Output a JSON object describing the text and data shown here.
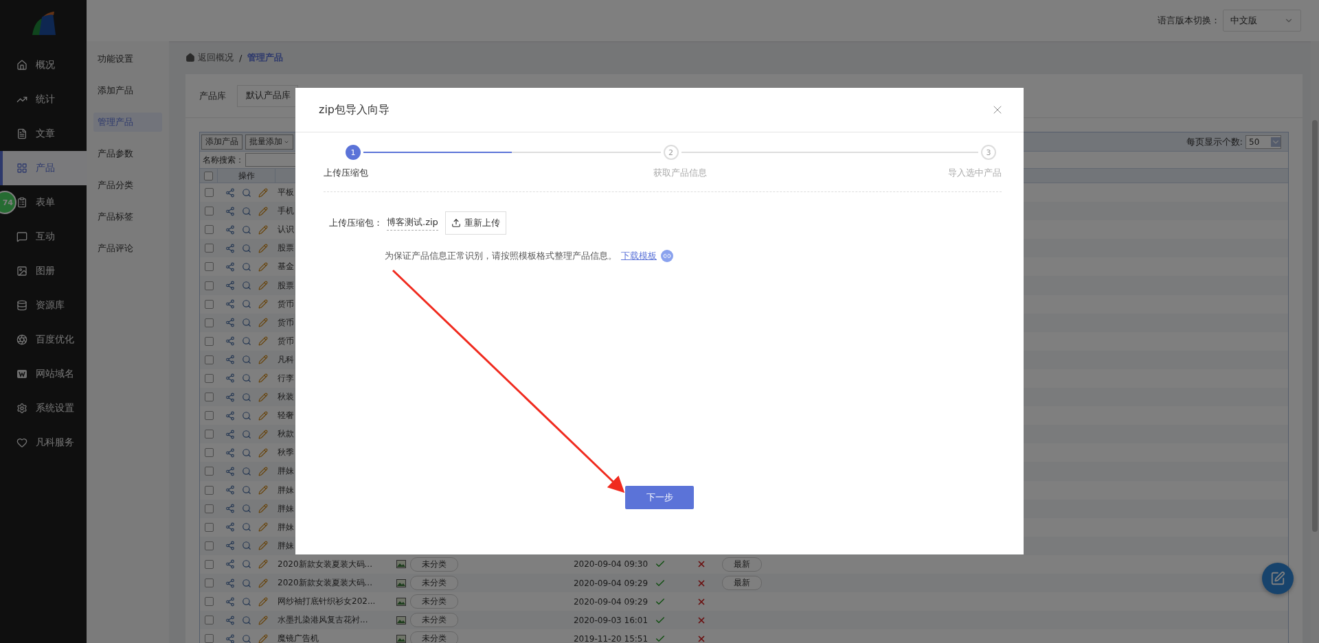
{
  "sidebar": {
    "items": [
      {
        "label": "概况",
        "selected": false
      },
      {
        "label": "统计",
        "selected": false
      },
      {
        "label": "文章",
        "selected": false
      },
      {
        "label": "产品",
        "selected": true
      },
      {
        "label": "表单",
        "selected": false,
        "badge": "74"
      },
      {
        "label": "互动",
        "selected": false
      },
      {
        "label": "图册",
        "selected": false
      },
      {
        "label": "资源库",
        "selected": false
      },
      {
        "label": "百度优化",
        "selected": false
      },
      {
        "label": "网站域名",
        "selected": false
      },
      {
        "label": "系统设置",
        "selected": false
      },
      {
        "label": "凡科服务",
        "selected": false
      }
    ]
  },
  "submenu": {
    "items": [
      {
        "label": "功能设置",
        "selected": false
      },
      {
        "label": "添加产品",
        "selected": false
      },
      {
        "label": "管理产品",
        "selected": true
      },
      {
        "label": "产品参数",
        "selected": false
      },
      {
        "label": "产品分类",
        "selected": false
      },
      {
        "label": "产品标签",
        "selected": false
      },
      {
        "label": "产品评论",
        "selected": false
      }
    ]
  },
  "header": {
    "language_label": "语言版本切换：",
    "language_value": "中文版"
  },
  "breadcrumb": {
    "back": "返回概况",
    "separator": "/",
    "current": "管理产品"
  },
  "library": {
    "label": "产品库",
    "value": "默认产品库"
  },
  "toolbar": {
    "buttons": [
      "添加产品",
      "批量添加"
    ],
    "page_size_label": "每页显示个数:",
    "page_size": "50"
  },
  "search": {
    "label": "名称搜索："
  },
  "table": {
    "select_all_checked": false,
    "columns": [
      "操作"
    ],
    "rows": [
      {
        "checked": false,
        "name": "平板"
      },
      {
        "checked": false,
        "name": "手机"
      },
      {
        "checked": false,
        "name": "认识"
      },
      {
        "checked": false,
        "name": "股票"
      },
      {
        "checked": false,
        "name": "基金"
      },
      {
        "checked": false,
        "name": "股票"
      },
      {
        "checked": false,
        "name": "货币"
      },
      {
        "checked": false,
        "name": "货币"
      },
      {
        "checked": false,
        "name": "货币"
      },
      {
        "checked": false,
        "name": "凡科"
      },
      {
        "checked": false,
        "name": "行李"
      },
      {
        "checked": false,
        "name": "秋装"
      },
      {
        "checked": false,
        "name": "轻奢"
      },
      {
        "checked": false,
        "name": "秋款"
      },
      {
        "checked": false,
        "name": "秋季"
      },
      {
        "checked": false,
        "name": "胖妹"
      },
      {
        "checked": false,
        "name": "胖妹"
      },
      {
        "checked": false,
        "name": "胖妹"
      },
      {
        "checked": false,
        "name": "胖妹"
      },
      {
        "checked": false,
        "name": "胖妹"
      },
      {
        "checked": false,
        "name": "2020新款女装夏装大码...",
        "category": "未分类",
        "time": "2020-09-04 09:30",
        "column_6": true,
        "column_7": false,
        "tag": "最新"
      },
      {
        "checked": false,
        "name": "2020新款女装夏装大码...",
        "category": "未分类",
        "time": "2020-09-04 09:29",
        "column_6": true,
        "column_7": false,
        "tag": "最新"
      },
      {
        "checked": false,
        "name": "网纱袖打底针织衫女202...",
        "category": "未分类",
        "time": "2020-09-04 09:29",
        "column_6": true,
        "column_7": false
      },
      {
        "checked": false,
        "name": "水墨扎染港风复古花衬...",
        "category": "未分类",
        "time": "2020-09-03 16:01",
        "column_6": true,
        "column_7": false
      },
      {
        "checked": false,
        "name": "魔镜广告机",
        "category": "未分类",
        "time": "2019-11-20 15:51",
        "column_6": true,
        "column_7": false
      }
    ]
  },
  "modal": {
    "title": "zip包导入向导",
    "steps": [
      {
        "number": "1",
        "label": "上传压缩包",
        "selected": true
      },
      {
        "number": "2",
        "label": "获取产品信息",
        "selected": false
      },
      {
        "number": "3",
        "label": "导入选中产品",
        "selected": false
      }
    ],
    "connectors": [
      {
        "level": 0.5
      }
    ],
    "upload": {
      "label": "上传压缩包：",
      "file": "博客测试.zip",
      "button": "重新上传"
    },
    "note": {
      "text": "为保证产品信息正常识别，请按照模板格式整理产品信息。",
      "link": "下载模板"
    },
    "next_button": "下一步"
  }
}
